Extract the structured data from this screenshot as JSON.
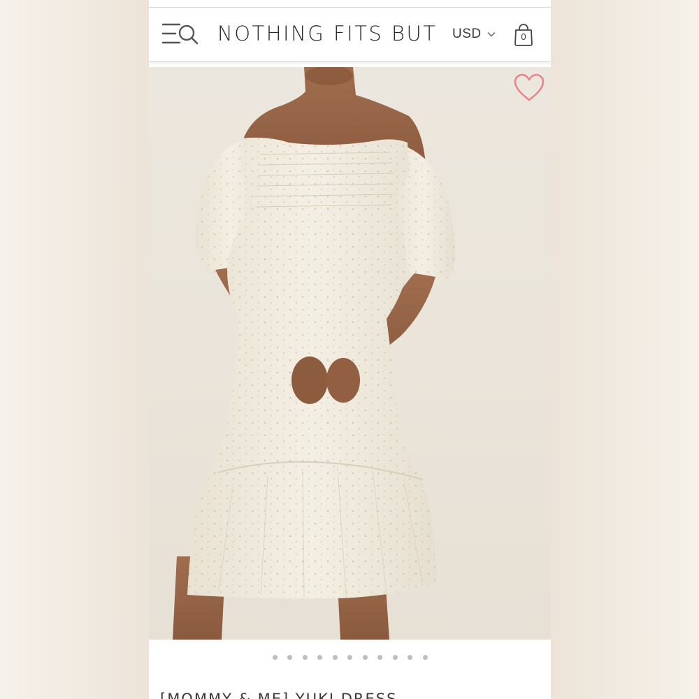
{
  "header": {
    "brand": "NOTHING FITS BUT",
    "currency": "USD",
    "cart_count": "0"
  },
  "product": {
    "title": "[MOMMY & ME] YUKI DRESS",
    "image_alt": "Off-shoulder smocked floral midi dress with puff sleeves and tiered ruffle hem",
    "image_count": 11,
    "active_image": 0
  },
  "colors": {
    "background": "#f3eee7",
    "heart": "#e7868a",
    "text": "#2a2a2a",
    "dot": "#bdbdbd",
    "dot_active": "#8a8a8a"
  },
  "icons": {
    "menu": "menu-search-icon",
    "currency_dropdown": "chevron-down-icon",
    "cart": "shopping-bag-icon",
    "wishlist": "heart-icon"
  }
}
